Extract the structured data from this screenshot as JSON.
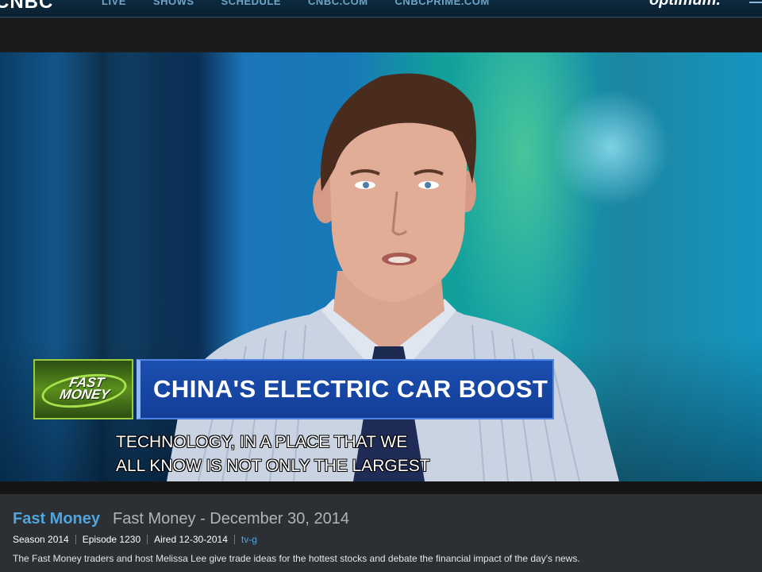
{
  "nav": {
    "logo": "CNBC",
    "links": [
      "LIVE",
      "SHOWS",
      "SCHEDULE",
      "CNBC.COM",
      "CNBCPRIME.COM"
    ],
    "brand": "optimum."
  },
  "video": {
    "show_logo": "FAST MONEY",
    "headline": "CHINA'S ELECTRIC CAR BOOST",
    "caption_lines": [
      "TECHNOLOGY, IN A PLACE THAT WE",
      "ALL KNOW IS NOT ONLY THE LARGEST"
    ]
  },
  "episode": {
    "show_name": "Fast Money",
    "title": "Fast Money - December 30, 2014",
    "season": "Season 2014",
    "episode": "Episode 1230",
    "aired": "Aired 12-30-2014",
    "rating": "tv-g",
    "description": "The Fast Money traders and host Melissa Lee give trade ideas for the hottest stocks and debate the financial impact of the day's news."
  },
  "colors": {
    "accent": "#4fa6de",
    "nav_bg": "#0c2a3f",
    "headline_bg": "#1c4fb0",
    "logo_green": "#5a8f1c"
  }
}
